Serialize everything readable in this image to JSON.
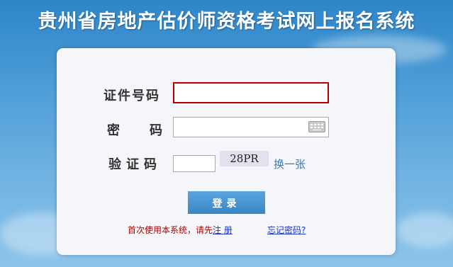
{
  "header": {
    "title": "贵州省房地产估价师资格考试网上报名系统"
  },
  "form": {
    "id_label": "证件号码",
    "id_value": "",
    "password_label": "密　码",
    "password_value": "",
    "captcha_label": "验证码",
    "captcha_value": "",
    "captcha_code": "28PR",
    "refresh_label": "换一张",
    "login_label": "登录"
  },
  "footer": {
    "prompt": "首次使用本系统，请先",
    "register_label": "注 册",
    "forgot_label": "忘记密码?"
  },
  "colors": {
    "accent": "#3a86c6",
    "error_border": "#b30000",
    "prompt": "#b00000",
    "link": "#1a32c8"
  }
}
